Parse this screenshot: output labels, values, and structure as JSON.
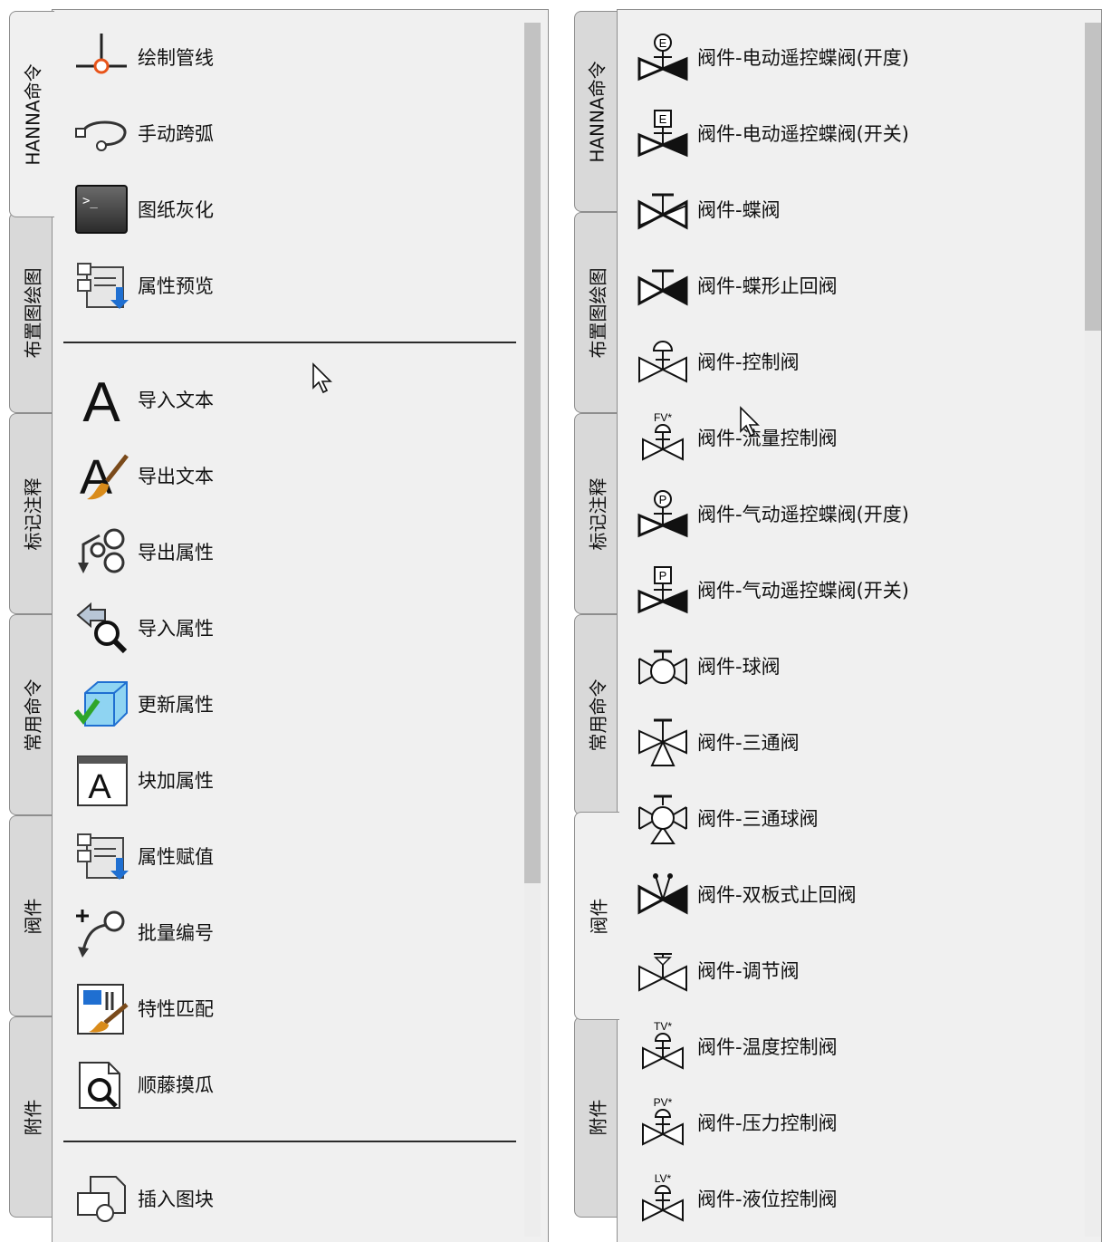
{
  "left_panel": {
    "tabs": [
      {
        "label": "HANNA命令",
        "active": true
      },
      {
        "label": "布置图绘图",
        "active": false
      },
      {
        "label": "标记注释",
        "active": false
      },
      {
        "label": "常用命令",
        "active": false
      },
      {
        "label": "阀件",
        "active": false
      },
      {
        "label": "附件",
        "active": false
      }
    ],
    "group1": [
      {
        "label": "绘制管线",
        "icon": "draw-pipe-icon"
      },
      {
        "label": "手动跨弧",
        "icon": "cross-arc-icon"
      },
      {
        "label": "图纸灰化",
        "icon": "console-gray-icon"
      },
      {
        "label": "属性预览",
        "icon": "attribute-preview-icon"
      }
    ],
    "group2": [
      {
        "label": "导入文本",
        "icon": "letter-a-icon"
      },
      {
        "label": "导出文本",
        "icon": "letter-a-brush-icon"
      },
      {
        "label": "导出属性",
        "icon": "export-attribute-icon"
      },
      {
        "label": "导入属性",
        "icon": "import-attribute-icon"
      },
      {
        "label": "更新属性",
        "icon": "cube-check-icon"
      },
      {
        "label": "块加属性",
        "icon": "block-attribute-icon"
      },
      {
        "label": "属性赋值",
        "icon": "attribute-assign-icon"
      },
      {
        "label": "批量编号",
        "icon": "batch-number-icon"
      },
      {
        "label": "特性匹配",
        "icon": "match-properties-icon"
      },
      {
        "label": "顺藤摸瓜",
        "icon": "trace-search-icon"
      }
    ],
    "group3": [
      {
        "label": "插入图块",
        "icon": "insert-block-icon"
      }
    ]
  },
  "right_panel": {
    "tabs": [
      {
        "label": "HANNA命令",
        "active": false
      },
      {
        "label": "布置图绘图",
        "active": false
      },
      {
        "label": "标记注释",
        "active": false
      },
      {
        "label": "常用命令",
        "active": false
      },
      {
        "label": "阀件",
        "active": true
      },
      {
        "label": "附件",
        "active": false
      }
    ],
    "items": [
      {
        "label": "阀件-电动遥控蝶阀(开度)",
        "icon": "electric-butterfly-valve-icon",
        "tag": "E"
      },
      {
        "label": "阀件-电动遥控蝶阀(开关)",
        "icon": "electric-butterfly-valve-switch-icon",
        "tag": "E"
      },
      {
        "label": "阀件-蝶阀",
        "icon": "butterfly-valve-icon"
      },
      {
        "label": "阀件-蝶形止回阀",
        "icon": "butterfly-check-valve-icon"
      },
      {
        "label": "阀件-控制阀",
        "icon": "control-valve-icon"
      },
      {
        "label": "阀件-流量控制阀",
        "icon": "flow-control-valve-icon",
        "tag": "FV*"
      },
      {
        "label": "阀件-气动遥控蝶阀(开度)",
        "icon": "pneumatic-butterfly-valve-icon",
        "tag": "P"
      },
      {
        "label": "阀件-气动遥控蝶阀(开关)",
        "icon": "pneumatic-butterfly-valve-switch-icon",
        "tag": "P"
      },
      {
        "label": "阀件-球阀",
        "icon": "ball-valve-icon"
      },
      {
        "label": "阀件-三通阀",
        "icon": "three-way-valve-icon"
      },
      {
        "label": "阀件-三通球阀",
        "icon": "three-way-ball-valve-icon"
      },
      {
        "label": "阀件-双板式止回阀",
        "icon": "dual-plate-check-valve-icon"
      },
      {
        "label": "阀件-调节阀",
        "icon": "regulating-valve-icon"
      },
      {
        "label": "阀件-温度控制阀",
        "icon": "temperature-control-valve-icon",
        "tag": "TV*"
      },
      {
        "label": "阀件-压力控制阀",
        "icon": "pressure-control-valve-icon",
        "tag": "PV*"
      },
      {
        "label": "阀件-液位控制阀",
        "icon": "level-control-valve-icon",
        "tag": "LV*"
      }
    ]
  },
  "colors": {
    "panel_bg": "#f0f0f0",
    "tab_bg": "#d9d9d9",
    "accent_orange": "#e8541a",
    "accent_blue": "#1f6fd1",
    "accent_green": "#2fa52a"
  }
}
